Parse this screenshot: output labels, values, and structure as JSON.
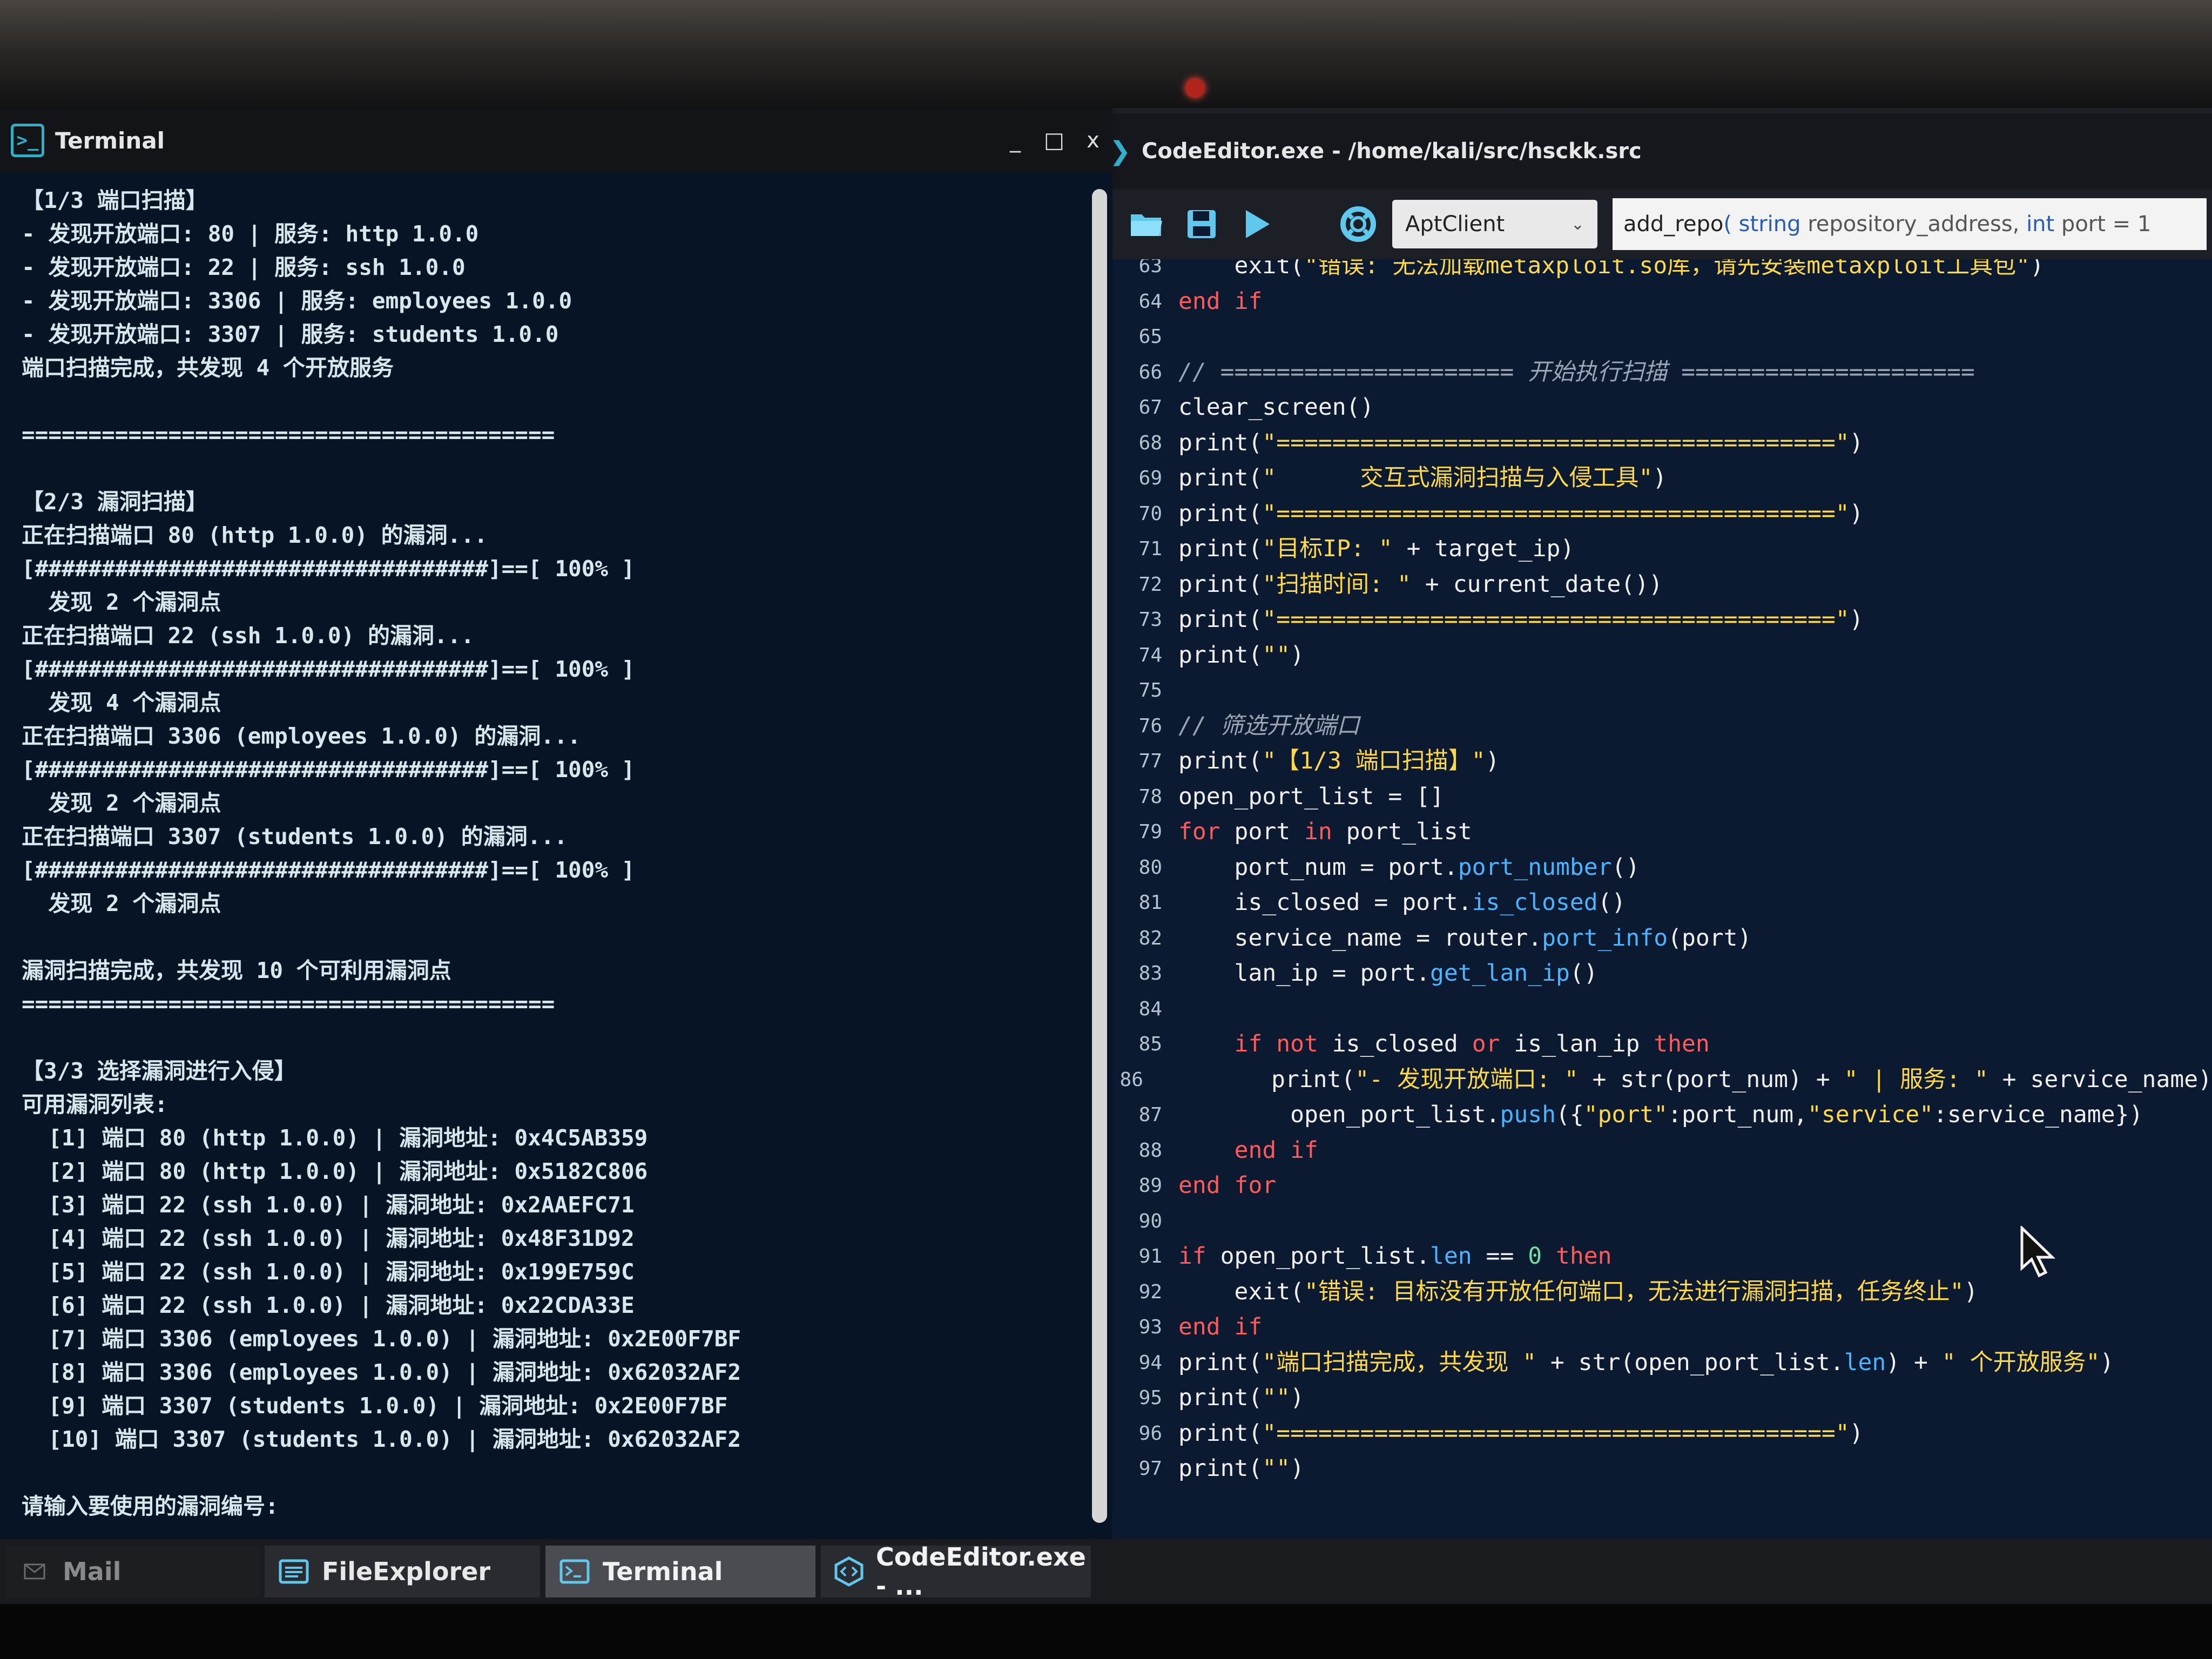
{
  "terminal": {
    "title": "Terminal",
    "controls": {
      "minimize": "_",
      "maximize": "□",
      "close": "x"
    },
    "lines": [
      "【1/3 端口扫描】",
      "- 发现开放端口: 80 | 服务: http 1.0.0",
      "- 发现开放端口: 22 | 服务: ssh 1.0.0",
      "- 发现开放端口: 3306 | 服务: employees 1.0.0",
      "- 发现开放端口: 3307 | 服务: students 1.0.0",
      "端口扫描完成，共发现 4 个开放服务",
      "",
      "========================================",
      "",
      "【2/3 漏洞扫描】",
      "正在扫描端口 80 (http 1.0.0) 的漏洞...",
      "[##################################]==[ 100% ]",
      "  发现 2 个漏洞点",
      "正在扫描端口 22 (ssh 1.0.0) 的漏洞...",
      "[##################################]==[ 100% ]",
      "  发现 4 个漏洞点",
      "正在扫描端口 3306 (employees 1.0.0) 的漏洞...",
      "[##################################]==[ 100% ]",
      "  发现 2 个漏洞点",
      "正在扫描端口 3307 (students 1.0.0) 的漏洞...",
      "[##################################]==[ 100% ]",
      "  发现 2 个漏洞点",
      "",
      "漏洞扫描完成，共发现 10 个可利用漏洞点",
      "========================================",
      "",
      "【3/3 选择漏洞进行入侵】",
      "可用漏洞列表:",
      "  [1] 端口 80 (http 1.0.0) | 漏洞地址: 0x4C5AB359",
      "  [2] 端口 80 (http 1.0.0) | 漏洞地址: 0x5182C806",
      "  [3] 端口 22 (ssh 1.0.0) | 漏洞地址: 0x2AAEFC71",
      "  [4] 端口 22 (ssh 1.0.0) | 漏洞地址: 0x48F31D92",
      "  [5] 端口 22 (ssh 1.0.0) | 漏洞地址: 0x199E759C",
      "  [6] 端口 22 (ssh 1.0.0) | 漏洞地址: 0x22CDA33E",
      "  [7] 端口 3306 (employees 1.0.0) | 漏洞地址: 0x2E00F7BF",
      "  [8] 端口 3306 (employees 1.0.0) | 漏洞地址: 0x62032AF2",
      "  [9] 端口 3307 (students 1.0.0) | 漏洞地址: 0x2E00F7BF",
      "  [10] 端口 3307 (students 1.0.0) | 漏洞地址: 0x62032AF2",
      "",
      "请输入要使用的漏洞编号:"
    ]
  },
  "editor": {
    "title": "CodeEditor.exe - /home/kali/src/hsckk.src",
    "toolbar": {
      "open_icon": "folder-open-icon",
      "save_icon": "save-icon",
      "run_icon": "play-icon",
      "help_icon": "lifebuoy-icon",
      "class_select": "AptClient",
      "signature": {
        "fn": "add_repo",
        "open": "( ",
        "t1": "string",
        "p1": " repository_address, ",
        "t2": "int",
        "p2": " port = 1"
      }
    },
    "code": [
      {
        "n": "63",
        "t": "    exit(\"错误: 无法加载metaxploit.so库，请先安装metaxploit工具包\")"
      },
      {
        "n": "64",
        "t": "end if"
      },
      {
        "n": "65",
        "t": ""
      },
      {
        "n": "66",
        "t": "// ===================== 开始执行扫描 ====================="
      },
      {
        "n": "67",
        "t": "clear_screen()"
      },
      {
        "n": "68",
        "t": "print(\"========================================\")"
      },
      {
        "n": "69",
        "t": "print(\"      交互式漏洞扫描与入侵工具\")"
      },
      {
        "n": "70",
        "t": "print(\"========================================\")"
      },
      {
        "n": "71",
        "t": "print(\"目标IP: \" + target_ip)"
      },
      {
        "n": "72",
        "t": "print(\"扫描时间: \" + current_date())"
      },
      {
        "n": "73",
        "t": "print(\"========================================\")"
      },
      {
        "n": "74",
        "t": "print(\"\")"
      },
      {
        "n": "75",
        "t": ""
      },
      {
        "n": "76",
        "t": "// 筛选开放端口"
      },
      {
        "n": "77",
        "t": "print(\"【1/3 端口扫描】\")"
      },
      {
        "n": "78",
        "t": "open_port_list = []"
      },
      {
        "n": "79",
        "t": "for port in port_list"
      },
      {
        "n": "80",
        "t": "    port_num = port.port_number()"
      },
      {
        "n": "81",
        "t": "    is_closed = port.is_closed()"
      },
      {
        "n": "82",
        "t": "    service_name = router.port_info(port)"
      },
      {
        "n": "83",
        "t": "    lan_ip = port.get_lan_ip()"
      },
      {
        "n": "84",
        "t": ""
      },
      {
        "n": "85",
        "t": "    if not is_closed or is_lan_ip then"
      },
      {
        "n": "86",
        "t": "        print(\"- 发现开放端口: \" + str(port_num) + \" | 服务: \" + service_name)"
      },
      {
        "n": "87",
        "t": "        open_port_list.push({\"port\":port_num,\"service\":service_name})"
      },
      {
        "n": "88",
        "t": "    end if"
      },
      {
        "n": "89",
        "t": "end for"
      },
      {
        "n": "90",
        "t": ""
      },
      {
        "n": "91",
        "t": "if open_port_list.len == 0 then"
      },
      {
        "n": "92",
        "t": "    exit(\"错误: 目标没有开放任何端口，无法进行漏洞扫描，任务终止\")"
      },
      {
        "n": "93",
        "t": "end if"
      },
      {
        "n": "94",
        "t": "print(\"端口扫描完成，共发现 \" + str(open_port_list.len) + \" 个开放服务\")"
      },
      {
        "n": "95",
        "t": "print(\"\")"
      },
      {
        "n": "96",
        "t": "print(\"========================================\")"
      },
      {
        "n": "97",
        "t": "print(\"\")"
      }
    ]
  },
  "taskbar": {
    "items": [
      {
        "label": "Mail",
        "icon": "mail-icon",
        "active": false
      },
      {
        "label": "FileExplorer",
        "icon": "file-explorer-icon",
        "active": false
      },
      {
        "label": "Terminal",
        "icon": "terminal-icon",
        "active": true
      },
      {
        "label": "CodeEditor.exe - ...",
        "icon": "code-editor-icon",
        "active": false
      }
    ]
  },
  "colors": {
    "terminal_bg": "#061426",
    "editor_bg": "#0b1a30",
    "keyword": "#ff5a5a",
    "string": "#ffd84a",
    "method": "#4ab4ff",
    "accent": "#2fb0c8"
  }
}
